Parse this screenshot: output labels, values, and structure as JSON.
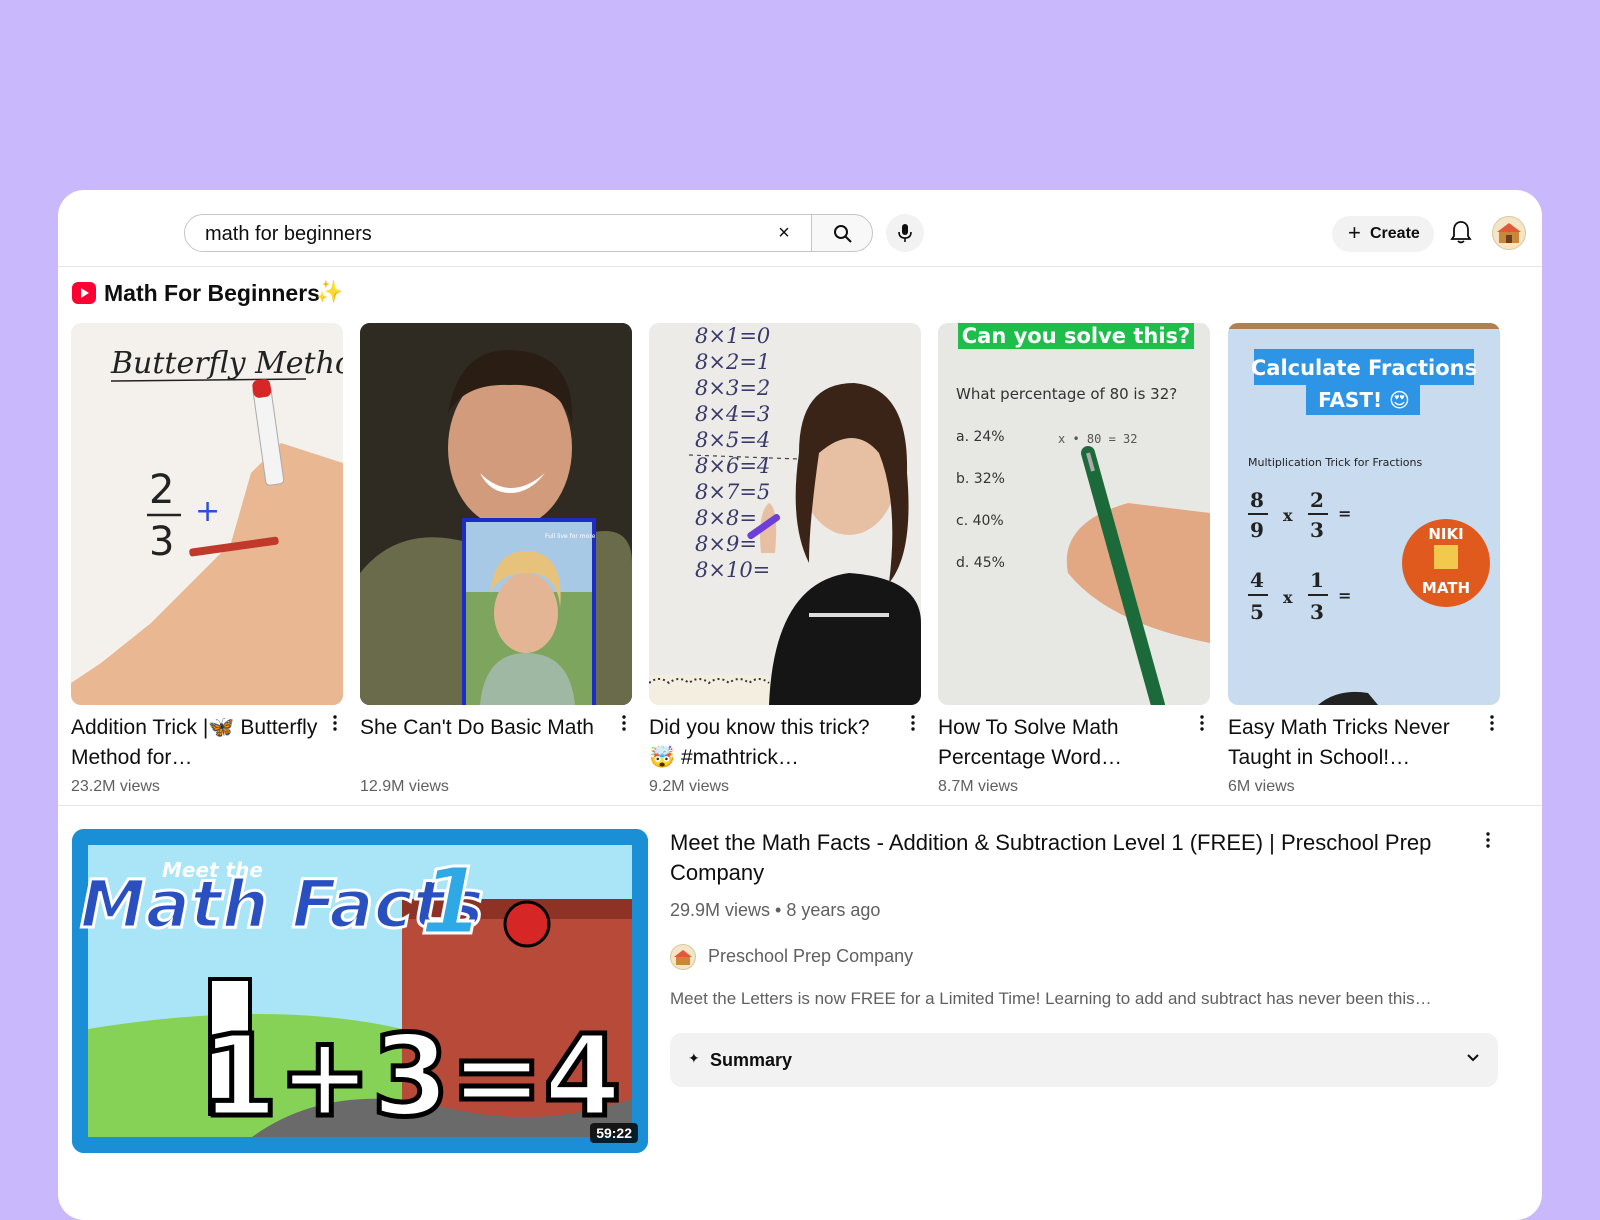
{
  "search": {
    "query": "math for beginners",
    "clear_glyph": "×"
  },
  "header": {
    "create_label": "Create",
    "create_glyph": "+"
  },
  "shorts": {
    "section_title": "Math For Beginners",
    "sparkle": "✨",
    "items": [
      {
        "title": "Addition Trick |🦋 Butterfly Method for…",
        "views": "23.2M views"
      },
      {
        "title": "She Can't Do Basic Math",
        "views": "12.9M views"
      },
      {
        "title": "Did you know this trick? 🤯 #mathtrick…",
        "views": "9.2M views"
      },
      {
        "title": "How To Solve Math Percentage Word…",
        "views": "8.7M views"
      },
      {
        "title": "Easy Math Tricks Never Taught in School!…",
        "views": "6M views"
      }
    ]
  },
  "thumbs": {
    "t1": {
      "heading": "Butterfly Method",
      "num": "2",
      "den": "3",
      "plus": "+"
    },
    "t2": {
      "caption": "Full live for more"
    },
    "t3": {
      "lines": [
        "8×1=0",
        "8×2=1",
        "8×3=2",
        "8×4=3",
        "8×5=4",
        "8×6=4",
        "8×7=5",
        "8×8=",
        "8×9=",
        "8×10="
      ]
    },
    "t4": {
      "banner": "Can you solve this?",
      "question": "What percentage of 80 is 32?",
      "options": [
        "a.  24%",
        "b.  32%",
        "c.  40%",
        "d.  45%"
      ],
      "work": "x • 80 = 32"
    },
    "t5": {
      "banner1": "Calculate Fractions",
      "banner2": "FAST! 😍",
      "sub": "Multiplication Trick for Fractions",
      "f1n": "8",
      "f1d": "9",
      "f2n": "2",
      "f2d": "3",
      "f3n": "4",
      "f3d": "5",
      "f4n": "1",
      "f4d": "3",
      "times": "x",
      "eq": "=",
      "logo1": "NIKI",
      "logo2": "MATH"
    }
  },
  "video": {
    "thumb_top": "Meet the",
    "thumb_title": "Math Facts",
    "thumb_num": "1",
    "thumb_equation": "1+3=4",
    "duration": "59:22",
    "title": "Meet the Math Facts - Addition & Subtraction Level 1 (FREE) | Preschool Prep Company",
    "meta": "29.9M views • 8 years ago",
    "channel": "Preschool Prep Company",
    "description": "Meet the Letters is now FREE for a Limited Time! Learning to add and subtract has never been this…",
    "summary_label": "Summary",
    "summary_glyph": "✦"
  },
  "colors": {
    "accent_red": "#ff0033",
    "page_bg": "#c9b9fc",
    "muted_text": "#606060"
  }
}
